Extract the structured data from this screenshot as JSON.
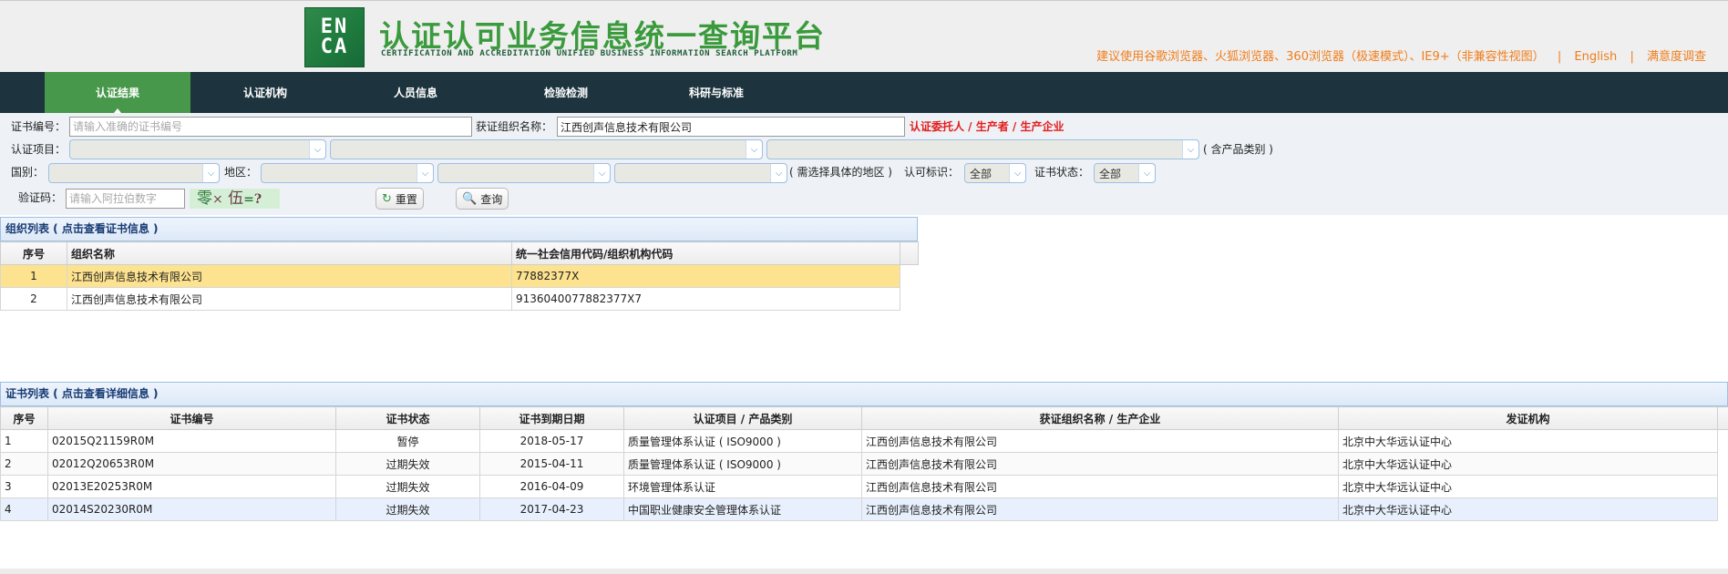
{
  "header": {
    "logo_top": "EN",
    "logo_bottom": "CA",
    "title": "认证认可业务信息统一查询平台",
    "subtitle": "CERTIFICATION AND ACCREDITATION UNIFIED BUSINESS INFORMATION SEARCH PLATFORM",
    "browser_note": "建议使用谷歌浏览器、火狐浏览器、360浏览器（极速模式）、IE9+（非兼容性视图）",
    "separator": "|",
    "english_link": "English",
    "survey_link": "满意度调查"
  },
  "nav": {
    "items": [
      {
        "label": "认证结果",
        "active": true
      },
      {
        "label": "认证机构",
        "active": false
      },
      {
        "label": "人员信息",
        "active": false
      },
      {
        "label": "检验检测",
        "active": false
      },
      {
        "label": "科研与标准",
        "active": false
      }
    ]
  },
  "form": {
    "cert_no_label": "证书编号：",
    "cert_no_placeholder": "请输入准确的证书编号",
    "cert_no_value": "",
    "org_name_label": "获证组织名称：",
    "org_name_value": "江西创声信息技术有限公司",
    "org_name_note": "认证委托人 / 生产者 / 生产企业",
    "cert_item_label": "认证项目：",
    "cert_item_note": "( 含产品类别 )",
    "country_label": "国别：",
    "region_label": "地区：",
    "region_note": "( 需选择具体的地区 )",
    "accredit_mark_label": "认可标识：",
    "accredit_mark_value": "全部",
    "cert_status_label": "证书状态：",
    "cert_status_value": "全部",
    "captcha_label": "验证码：",
    "captcha_placeholder": "请输入阿拉伯数字",
    "captcha_text": {
      "a": "零",
      "op": "×",
      "b": "伍",
      "eq": "=",
      "q": "?"
    },
    "reset_button": "重置",
    "search_button": "查询"
  },
  "org_list": {
    "title": "组织列表 ( 点击查看证书信息 )",
    "columns": [
      "序号",
      "组织名称",
      "统一社会信用代码/组织机构代码"
    ],
    "rows": [
      {
        "no": "1",
        "name": "江西创声信息技术有限公司",
        "code": "77882377X",
        "selected": true
      },
      {
        "no": "2",
        "name": "江西创声信息技术有限公司",
        "code": "913604007788237​7X7",
        "selected": false
      }
    ]
  },
  "cert_list": {
    "title": "证书列表 ( 点击查看详细信息 )",
    "columns": [
      "序号",
      "证书编号",
      "证书状态",
      "证书到期日期",
      "认证项目 / 产品类别",
      "获证组织名称 / 生产企业",
      "发证机构"
    ],
    "rows": [
      {
        "no": "1",
        "cert_no": "02015Q21159R0M",
        "status": "暂停",
        "expiry": "2018-05-17",
        "item": "质量管理体系认证 ( ISO9000 )",
        "org": "江西创声信息技术有限公司",
        "issuer": "北京中大华远认证中心"
      },
      {
        "no": "2",
        "cert_no": "02012Q20653R0M",
        "status": "过期失效",
        "expiry": "2015-04-11",
        "item": "质量管理体系认证 ( ISO9000 )",
        "org": "江西创声信息技术有限公司",
        "issuer": "北京中大华远认证中心"
      },
      {
        "no": "3",
        "cert_no": "02013E20253R0M",
        "status": "过期失效",
        "expiry": "2016-04-09",
        "item": "环境管理体系认证",
        "org": "江西创声信息技术有限公司",
        "issuer": "北京中大华远认证中心"
      },
      {
        "no": "4",
        "cert_no": "02014S20230R0M",
        "status": "过期失效",
        "expiry": "2017-04-23",
        "item": "中国职业健康安全管理体系认证",
        "org": "江西创声信息技术有限公司",
        "issuer": "北京中大华远认证中心"
      }
    ]
  }
}
